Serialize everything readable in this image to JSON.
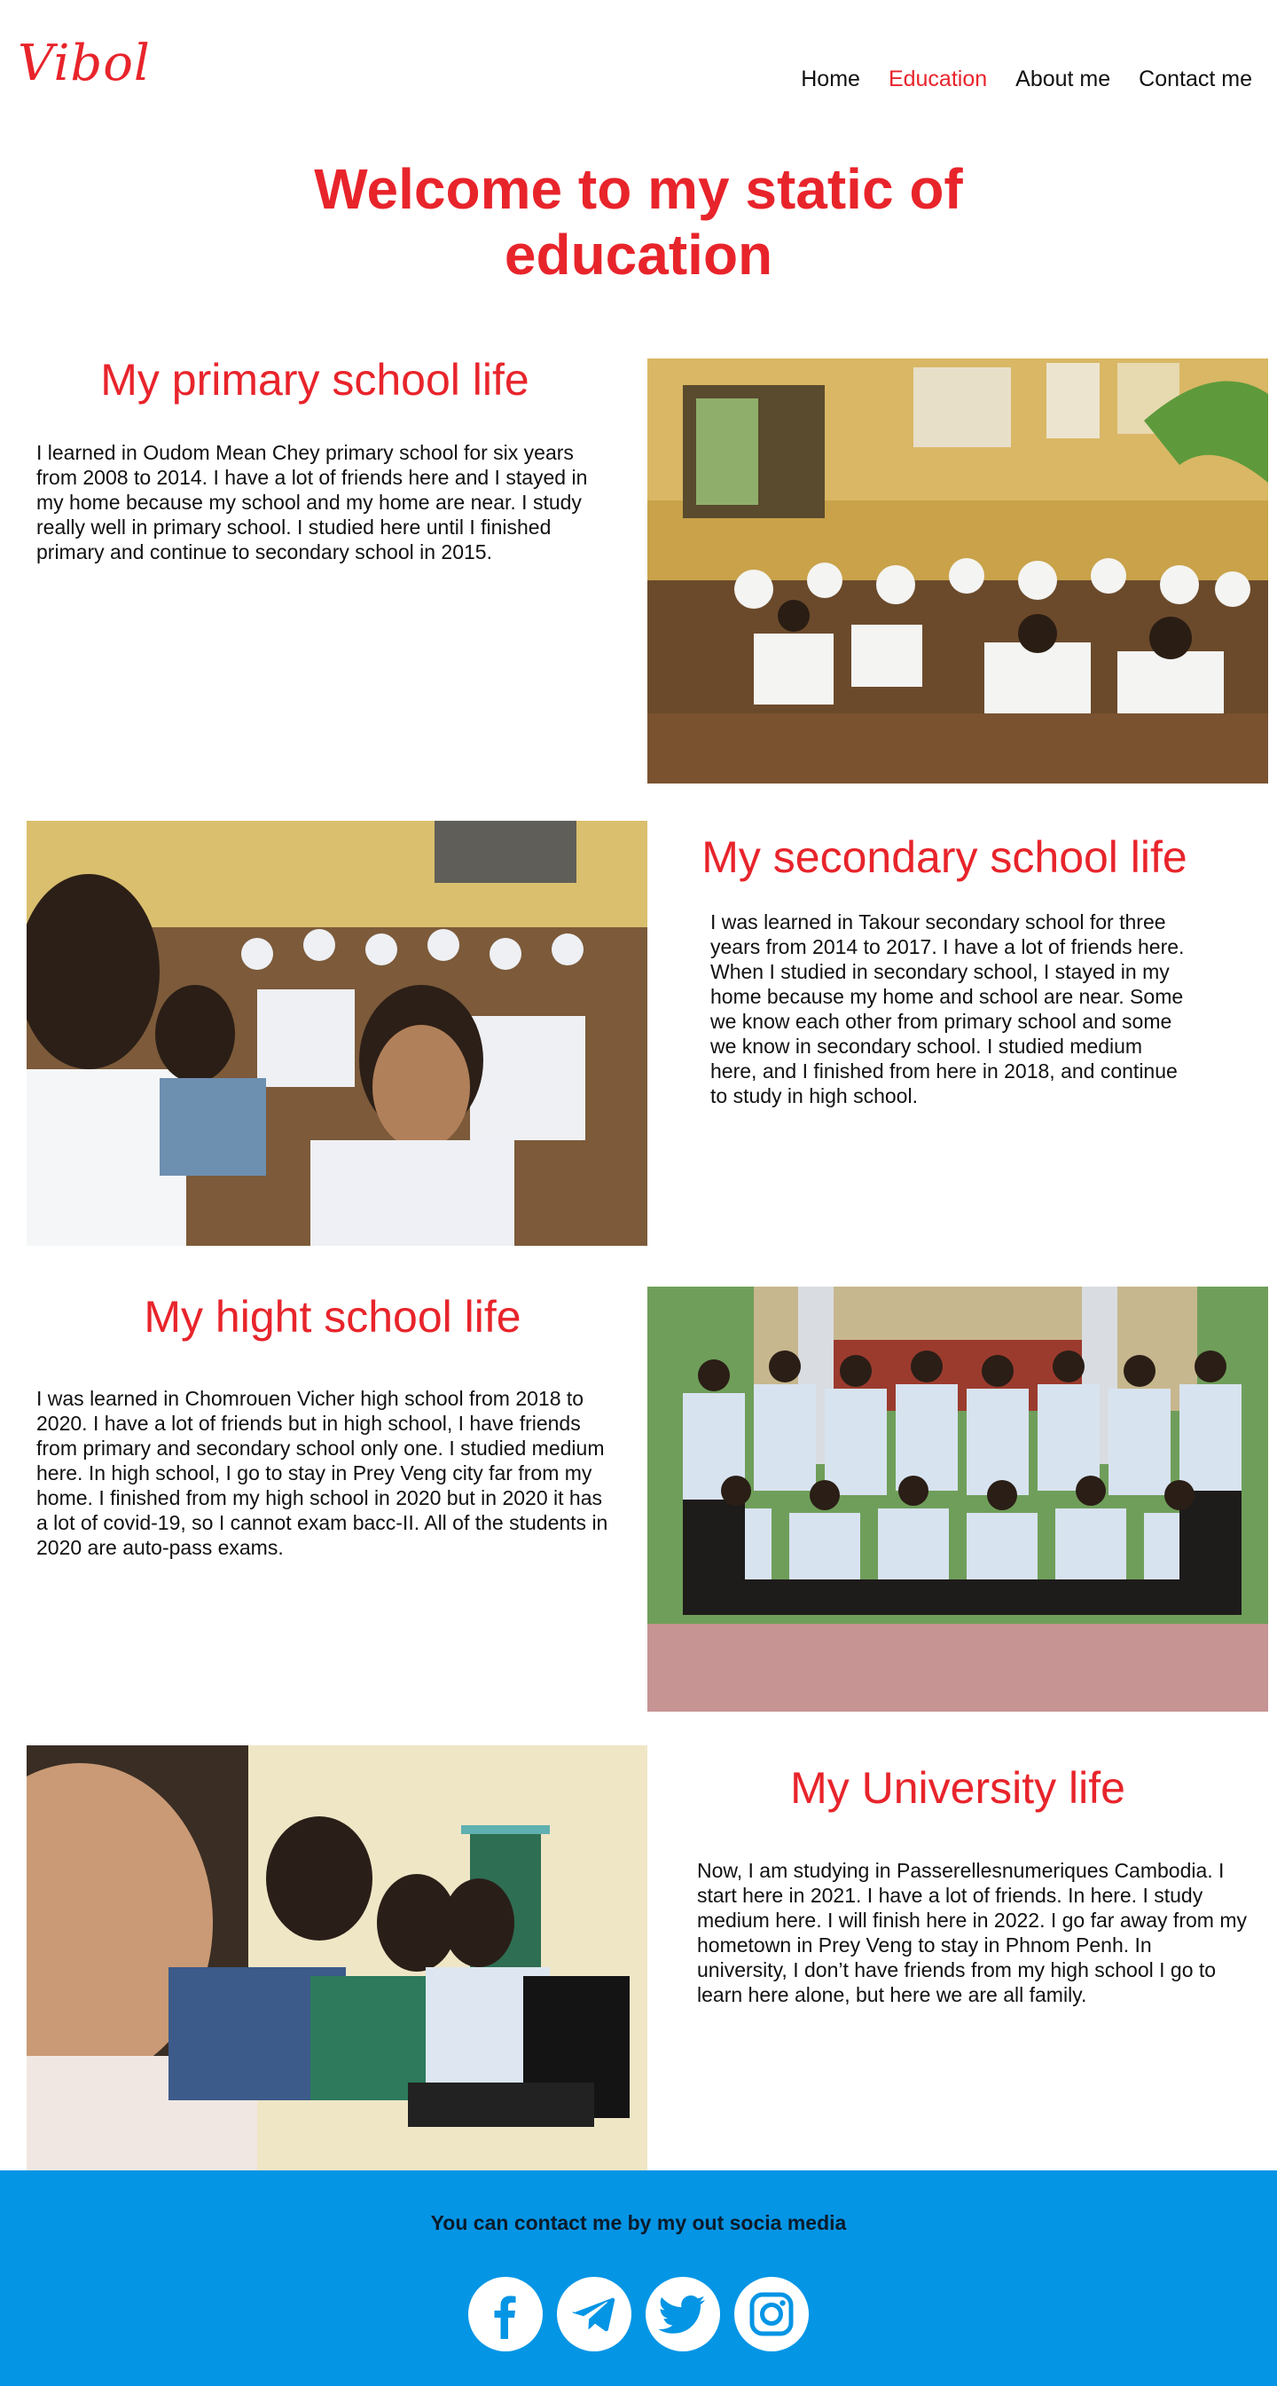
{
  "header": {
    "logo": "Vibol",
    "nav": [
      {
        "label": "Home",
        "icon": ""
      },
      {
        "label": "Education",
        "active": true
      },
      {
        "label": "About me"
      },
      {
        "label": "Contact me"
      }
    ]
  },
  "hero": {
    "title_line1": "Welcome to my static of",
    "title_line2": "education"
  },
  "sections": [
    {
      "heading": "My primary school life",
      "text": "I learned in Oudom Mean Chey primary school for six years from 2008 to 2014. I have a lot of friends here and I stayed in my home because my school and my home are near. I study really well in primary school. I studied here until I finished primary and continue to secondary school in 2015.",
      "photo": "classroom-students-photo"
    },
    {
      "heading": "My secondary school life",
      "text": "I was learned in Takour secondary school for three years from 2014 to 2017. I have a lot of friends here. When I studied in secondary school, I stayed in my home because my home and school are near. Some we know each other from primary school and some we know in secondary school. I studied medium here, and I finished from here in 2018, and continue to study in high school.",
      "photo": "secondary-students-photo"
    },
    {
      "heading": "My hight school life",
      "text": "I was learned in Chomrouen Vicher high school from 2018 to 2020. I have a lot of friends but in high school, I have friends from primary and secondary school only one. I studied medium here. In high school, I go to stay in Prey Veng city far from my home.  I finished from my high school in 2020 but in 2020 it has a lot of covid-19, so I cannot exam bacc-II. All of the students in 2020 are auto-pass exams.",
      "photo": "high-school-group-photo"
    },
    {
      "heading": "My University life",
      "text": "Now, I am studying in Passerellesnumeriques Cambodia. I start here in 2021. I have a lot of friends. In here. I study medium here. I will finish here in 2022. I go far away from my hometown in Prey Veng to stay in Phnom Penh. In university, I don’t have friends from my high school I go to learn here alone, but here we are all family.",
      "photo": "university-computer-photo"
    }
  ],
  "footer": {
    "text": "You can contact me by my out socia media",
    "socials": [
      "facebook-icon",
      "telegram-icon",
      "twitter-icon",
      "instagram-icon"
    ]
  },
  "colors": {
    "accent": "#e8242b",
    "footer_bg": "#0495e5"
  }
}
